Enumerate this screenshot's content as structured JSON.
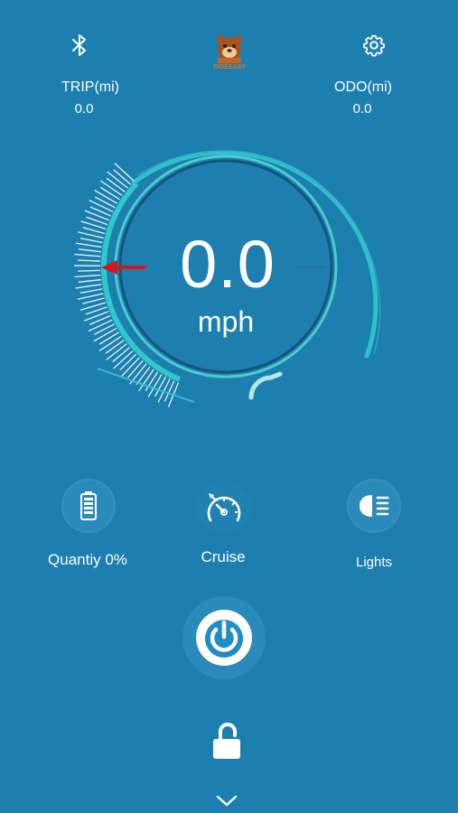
{
  "header": {
    "trip_label": "TRIP(mi)",
    "trip_value": "0.0",
    "odo_label": "ODO(mi)",
    "odo_value": "0.0",
    "logo_text": "RIDEEASY"
  },
  "gauge": {
    "speed_value": "0.0",
    "speed_unit": "mph"
  },
  "controls": {
    "battery_label": "Quantiy 0%",
    "battery_level": 0,
    "cruise_label": "Cruise",
    "lights_label": "Lights"
  },
  "colors": {
    "background": "#1d7fb0",
    "accent": "#2ec9c9",
    "needle": "#d21a1a"
  }
}
